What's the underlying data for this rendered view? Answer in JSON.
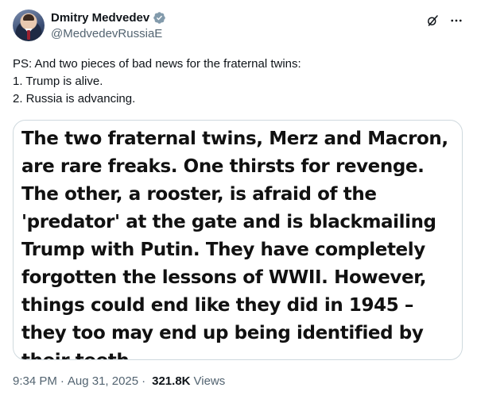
{
  "author": {
    "display_name": "Dmitry Medvedev",
    "handle": "@MedvedevRussiaE"
  },
  "tweet": {
    "text": "PS: And two pieces of bad news for the fraternal twins:\n1. Trump is alive.\n2. Russia is advancing.",
    "image_text": "The two fraternal twins, Merz and Macron, are rare freaks. One thirsts for revenge. The other, a rooster, is afraid of the 'predator' at the gate and is blackmailing Trump with Putin. They have completely forgotten the lessons of WWII. However, things could end like they did in 1945 – they too may end up being identified by their teeth."
  },
  "meta": {
    "time": "9:34 PM",
    "separator": "·",
    "date": "Aug 31, 2025",
    "views_count": "321.8K",
    "views_label": "Views"
  },
  "icons": {
    "verified": "verified-badge-icon",
    "grok": "grok-icon",
    "more": "more-icon"
  },
  "colors": {
    "verified_badge": "#829aab",
    "secondary_text": "#536471",
    "primary_text": "#0f1419",
    "border": "#cfd9de"
  }
}
